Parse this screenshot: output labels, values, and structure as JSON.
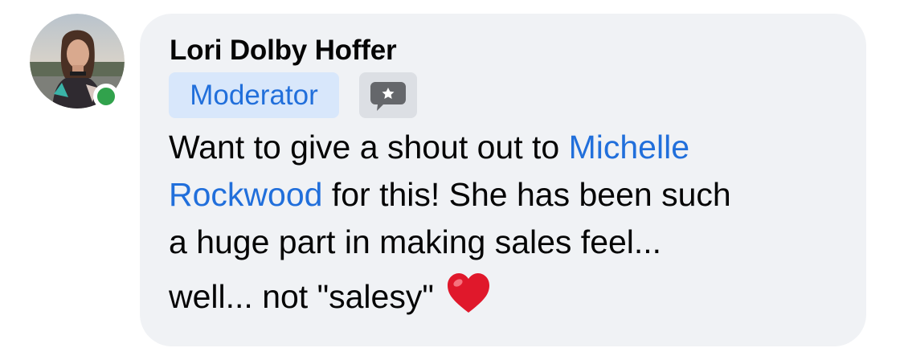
{
  "comment": {
    "author": "Lori Dolby Hoffer",
    "role_badge": "Moderator",
    "body": {
      "text_before_mention": "Want to give a shout out to ",
      "mention_part1": "Michelle",
      "mention_part2": "Rockwood",
      "text_after_mention": " for this! She has been such",
      "line3": "a huge part in making sales feel...",
      "line4": "well... not \"salesy\""
    },
    "emoji": "heart",
    "online_status_color": "#31a24c",
    "accent_color": "#216fdb"
  }
}
